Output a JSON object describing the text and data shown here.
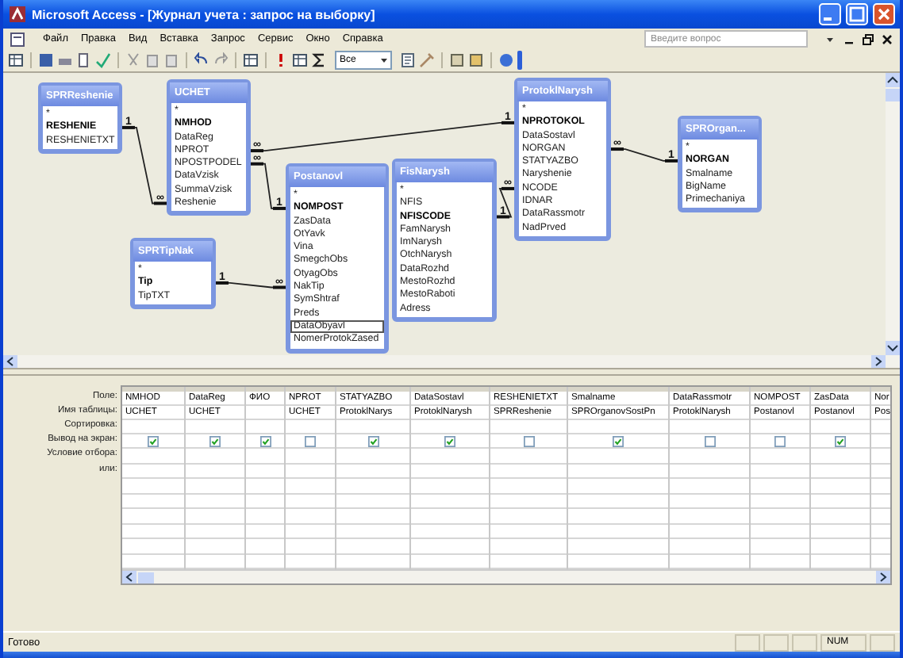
{
  "window": {
    "title": "Microsoft Access - [Журнал учета : запрос на выборку]"
  },
  "menu": [
    "Файл",
    "Правка",
    "Вид",
    "Вставка",
    "Запрос",
    "Сервис",
    "Окно",
    "Справка"
  ],
  "help_search": {
    "placeholder": "Введите вопрос"
  },
  "toolbar": {
    "top_values": "Все"
  },
  "tables": [
    {
      "name": "SPRReshenie",
      "fields": [
        {
          "name": "*",
          "key": false
        },
        {
          "name": "RESHENIE",
          "key": true
        },
        {
          "name": "RESHENIETXT",
          "key": false
        }
      ]
    },
    {
      "name": "UCHET",
      "fields": [
        {
          "name": "*",
          "key": false
        },
        {
          "name": "NMHOD",
          "key": true
        },
        {
          "name": "DataReg",
          "key": false
        },
        {
          "name": "NPROT",
          "key": false
        },
        {
          "name": "NPOSTPODEL",
          "key": false
        },
        {
          "name": "DataVzisk",
          "key": false
        },
        {
          "name": "SummaVzisk",
          "key": false
        },
        {
          "name": "Reshenie",
          "key": false
        }
      ]
    },
    {
      "name": "ProtoklNarysh",
      "fields": [
        {
          "name": "*",
          "key": false
        },
        {
          "name": "NPROTOKOL",
          "key": true
        },
        {
          "name": "DataSostavl",
          "key": false
        },
        {
          "name": "NORGAN",
          "key": false
        },
        {
          "name": "STATYAZBO",
          "key": false
        },
        {
          "name": "Naryshenie",
          "key": false
        },
        {
          "name": "NCODE",
          "key": false
        },
        {
          "name": "IDNAR",
          "key": false
        },
        {
          "name": "DataRassmotr",
          "key": false
        },
        {
          "name": "NadPrved",
          "key": false
        }
      ]
    },
    {
      "name": "SPROrgan...",
      "fields": [
        {
          "name": "*",
          "key": false
        },
        {
          "name": "NORGAN",
          "key": true
        },
        {
          "name": "Smalname",
          "key": false
        },
        {
          "name": "BigName",
          "key": false
        },
        {
          "name": "Primechaniya",
          "key": false
        }
      ]
    },
    {
      "name": "Postanovl",
      "fields": [
        {
          "name": "*",
          "key": false,
          "selected": false
        },
        {
          "name": "NOMPOST",
          "key": true,
          "selected": false
        },
        {
          "name": "ZasData",
          "key": false,
          "selected": false
        },
        {
          "name": "OtYavk",
          "key": false,
          "selected": false
        },
        {
          "name": "Vina",
          "key": false,
          "selected": false
        },
        {
          "name": "SmegchObs",
          "key": false,
          "selected": false
        },
        {
          "name": "OtyagObs",
          "key": false,
          "selected": false
        },
        {
          "name": "NakTip",
          "key": false,
          "selected": false
        },
        {
          "name": "SymShtraf",
          "key": false,
          "selected": false
        },
        {
          "name": "Preds",
          "key": false,
          "selected": false
        },
        {
          "name": "DataObyavl",
          "key": false,
          "selected": true
        },
        {
          "name": "NomerProtokZased",
          "key": false,
          "selected": false
        }
      ]
    },
    {
      "name": "FisNarysh",
      "fields": [
        {
          "name": "*",
          "key": false
        },
        {
          "name": "NFIS",
          "key": false
        },
        {
          "name": "NFISCODE",
          "key": true
        },
        {
          "name": "FamNarysh",
          "key": false
        },
        {
          "name": "ImNarysh",
          "key": false
        },
        {
          "name": "OtchNarysh",
          "key": false
        },
        {
          "name": "DataRozhd",
          "key": false
        },
        {
          "name": "MestoRozhd",
          "key": false
        },
        {
          "name": "MestoRaboti",
          "key": false
        },
        {
          "name": "Adress",
          "key": false
        }
      ]
    },
    {
      "name": "SPRTipNak",
      "fields": [
        {
          "name": "*",
          "key": false
        },
        {
          "name": "Tip",
          "key": true
        },
        {
          "name": "TipTXT",
          "key": false
        }
      ]
    }
  ],
  "relations": [
    {
      "left_label": "1",
      "right_label": "∞"
    },
    {
      "left_label": "∞",
      "right_label": "1"
    },
    {
      "left_label": "∞",
      "right_label": "1"
    },
    {
      "left_label": "1",
      "right_label": "∞"
    },
    {
      "left_label": "1",
      "right_label": "∞"
    },
    {
      "left_label": "∞",
      "right_label": "1"
    }
  ],
  "grid": {
    "row_labels": [
      "Поле:",
      "Имя таблицы:",
      "Сортировка:",
      "Вывод на экран:",
      "Условие отбора:",
      "или:"
    ],
    "columns": [
      {
        "field": "NMHOD",
        "table": "UCHET",
        "show": true
      },
      {
        "field": "DataReg",
        "table": "UCHET",
        "show": true
      },
      {
        "field": "ФИО",
        "show": true
      },
      {
        "field": "NPROT",
        "table": "UCHET",
        "show": false
      },
      {
        "field": "STATYAZBO",
        "table": "ProtoklNarys",
        "show": true
      },
      {
        "field": "DataSostavl",
        "table": "ProtoklNarysh",
        "show": true
      },
      {
        "field": "RESHENIETXT",
        "table": "SPRReshenie",
        "show": false
      },
      {
        "field": "Smalname",
        "table": "SPROrganovSostPn",
        "show": true
      },
      {
        "field": "DataRassmotr",
        "table": "ProtoklNarysh",
        "show": false
      },
      {
        "field": "NOMPOST",
        "table": "Postanovl",
        "show": false
      },
      {
        "field": "ZasData",
        "table": "Postanovl",
        "show": true
      },
      {
        "field": "Nor",
        "table": "Pos"
      }
    ]
  },
  "status_bar": {
    "text": "Готово",
    "indicator": "NUM"
  }
}
